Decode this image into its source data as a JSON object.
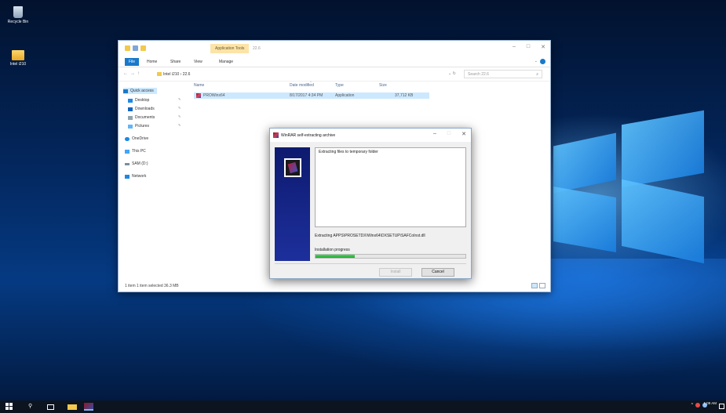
{
  "desktop": {
    "icons": [
      {
        "label": "Recycle Bin",
        "icon": "recycle-bin-icon"
      },
      {
        "label": "Intel i210",
        "icon": "folder-icon"
      }
    ]
  },
  "explorer": {
    "tools_tab": "Application Tools",
    "title": "22.6",
    "ribbon_tabs": [
      "File",
      "Home",
      "Share",
      "View",
      "Manage"
    ],
    "address": "Intel i210 › 22.6",
    "search_placeholder": "Search 22.6",
    "nav_items": [
      {
        "label": "Quick access",
        "icon": "star-icon",
        "color": "#1979ca"
      },
      {
        "label": "Desktop",
        "icon": "desktop-icon",
        "color": "#1e88e5"
      },
      {
        "label": "Downloads",
        "icon": "downloads-icon",
        "color": "#1565c0"
      },
      {
        "label": "Documents",
        "icon": "documents-icon",
        "color": "#90a4ae"
      },
      {
        "label": "Pictures",
        "icon": "pictures-icon",
        "color": "#64b5f6"
      },
      {
        "label": "OneDrive",
        "icon": "onedrive-icon",
        "color": "#1e88e5"
      },
      {
        "label": "This PC",
        "icon": "pc-icon",
        "color": "#42a5f5"
      },
      {
        "label": "SAM (D:)",
        "icon": "drive-icon",
        "color": "#78909c"
      },
      {
        "label": "Network",
        "icon": "network-icon",
        "color": "#1e88e5"
      }
    ],
    "columns": [
      "Name",
      "Date modified",
      "Type",
      "Size"
    ],
    "files": [
      {
        "name": "PROWinx64",
        "date": "8/17/2017 4:34 PM",
        "type": "Application",
        "size": "37,712 KB"
      }
    ],
    "status": "1 item    1 item selected  36.3 MB"
  },
  "winrar": {
    "title": "WinRAR self-extracting archive",
    "log_text": "Extracting files to temporary folder",
    "current_file": "Extracting APPS\\PROSETDX\\Winx64\\DXSETUP\\SAFCoInst.dll",
    "progress_label": "Installation progress",
    "progress": 0.26,
    "install_label": "Install",
    "cancel_label": "Cancel"
  },
  "taskbar": {
    "clock_time": "1:09 AM"
  }
}
